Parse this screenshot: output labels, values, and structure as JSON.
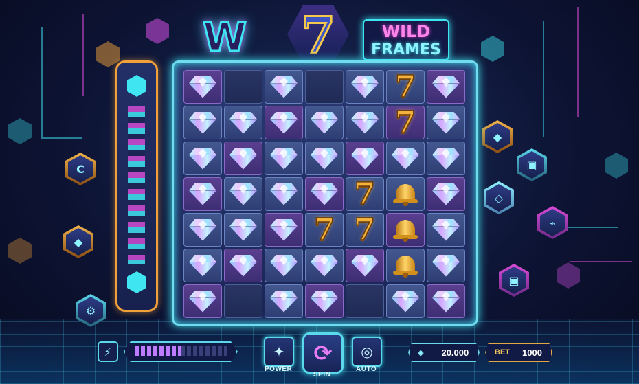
{
  "game": {
    "logo_letter": "W",
    "logo_number": "7",
    "title_line1": "WILD",
    "title_line2": "FRAMES"
  },
  "board": {
    "rows": [
      [
        "diamond",
        "empty",
        "diamond",
        "empty",
        "diamond",
        "seven",
        "diamond"
      ],
      [
        "diamond",
        "diamond",
        "diamond",
        "diamond",
        "diamond",
        "seven",
        "diamond"
      ],
      [
        "diamond",
        "diamond",
        "diamond",
        "diamond",
        "diamond",
        "diamond",
        "diamond"
      ],
      [
        "diamond",
        "diamond",
        "diamond",
        "diamond",
        "seven",
        "bell",
        "diamond"
      ],
      [
        "diamond",
        "diamond",
        "diamond",
        "seven",
        "seven",
        "bell",
        "diamond"
      ],
      [
        "diamond",
        "diamond",
        "diamond",
        "diamond",
        "diamond",
        "bell",
        "diamond"
      ],
      [
        "diamond",
        "empty",
        "diamond",
        "diamond",
        "empty",
        "diamond",
        "diamond"
      ]
    ],
    "symbol_seven": "7"
  },
  "controls": {
    "bolt_icon": "⚡",
    "power_level": 0.5,
    "power_label": "POWER",
    "spin_label": "SPIN",
    "auto_label": "AUTO",
    "balance": "20.000",
    "bet_label": "BET",
    "bet_value": "1000"
  },
  "colors": {
    "accent_cyan": "#3fe6f2",
    "accent_magenta": "#d94bd6",
    "gold": "#f2b23b"
  }
}
